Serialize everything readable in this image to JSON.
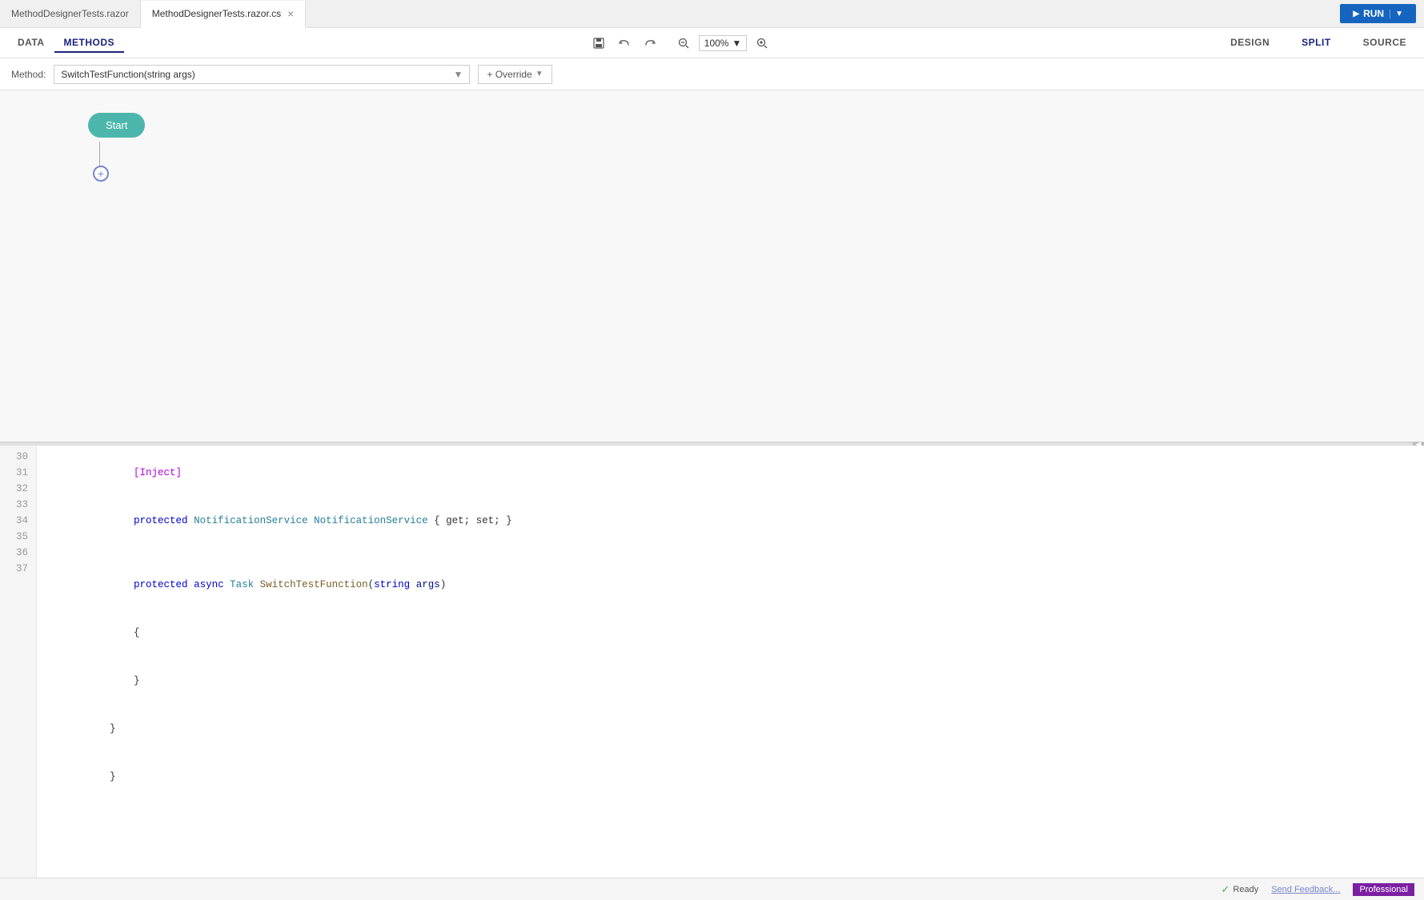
{
  "tabs": [
    {
      "id": "tab1",
      "label": "MethodDesignerTests.razor",
      "active": false,
      "closable": false
    },
    {
      "id": "tab2",
      "label": "MethodDesignerTests.razor.cs",
      "active": true,
      "closable": true
    }
  ],
  "run_button": {
    "label": "RUN"
  },
  "toolbar": {
    "tabs": [
      {
        "id": "data",
        "label": "DATA",
        "active": false
      },
      {
        "id": "methods",
        "label": "METHODS",
        "active": true
      }
    ],
    "zoom": "100%",
    "views": [
      {
        "id": "design",
        "label": "DESIGN",
        "active": false
      },
      {
        "id": "split",
        "label": "SPLIT",
        "active": true
      },
      {
        "id": "source",
        "label": "SOURCE",
        "active": false
      }
    ]
  },
  "method_bar": {
    "label": "Method:",
    "selected_method": "SwitchTestFunction(string args)",
    "override_label": "+ Override"
  },
  "designer": {
    "start_label": "Start",
    "add_btn_label": "+"
  },
  "code": {
    "lines": [
      {
        "num": "30",
        "content": "    [Inject]",
        "tokens": [
          {
            "text": "    [Inject]",
            "class": "attr"
          }
        ]
      },
      {
        "num": "31",
        "content": "    protected NotificationService NotificationService { get; set; }",
        "tokens": [
          {
            "text": "    ",
            "class": ""
          },
          {
            "text": "protected",
            "class": "kw"
          },
          {
            "text": " ",
            "class": ""
          },
          {
            "text": "NotificationService",
            "class": "type-name"
          },
          {
            "text": " ",
            "class": ""
          },
          {
            "text": "NotificationService",
            "class": "type-name"
          },
          {
            "text": " { get; set; }",
            "class": "punct"
          }
        ]
      },
      {
        "num": "32",
        "content": "",
        "tokens": []
      },
      {
        "num": "33",
        "content": "    protected async Task SwitchTestFunction(string args)",
        "tokens": [
          {
            "text": "    ",
            "class": ""
          },
          {
            "text": "protected",
            "class": "kw"
          },
          {
            "text": " ",
            "class": ""
          },
          {
            "text": "async",
            "class": "kw"
          },
          {
            "text": " ",
            "class": ""
          },
          {
            "text": "Task",
            "class": "type-name"
          },
          {
            "text": " ",
            "class": ""
          },
          {
            "text": "SwitchTestFunction",
            "class": "method-name"
          },
          {
            "text": "(",
            "class": "punct"
          },
          {
            "text": "string",
            "class": "kw"
          },
          {
            "text": " args)",
            "class": "param"
          }
        ]
      },
      {
        "num": "34",
        "content": "    {",
        "tokens": [
          {
            "text": "    {",
            "class": "punct"
          }
        ]
      },
      {
        "num": "35",
        "content": "    }",
        "tokens": [
          {
            "text": "    }",
            "class": "punct"
          }
        ]
      },
      {
        "num": "36",
        "content": "}",
        "tokens": [
          {
            "text": "}",
            "class": "punct"
          }
        ]
      },
      {
        "num": "37",
        "content": "}",
        "tokens": [
          {
            "text": "}",
            "class": "punct"
          }
        ]
      }
    ]
  },
  "status_bar": {
    "ready_label": "Ready",
    "feedback_label": "Send Feedback...",
    "edition_label": "Professional"
  }
}
